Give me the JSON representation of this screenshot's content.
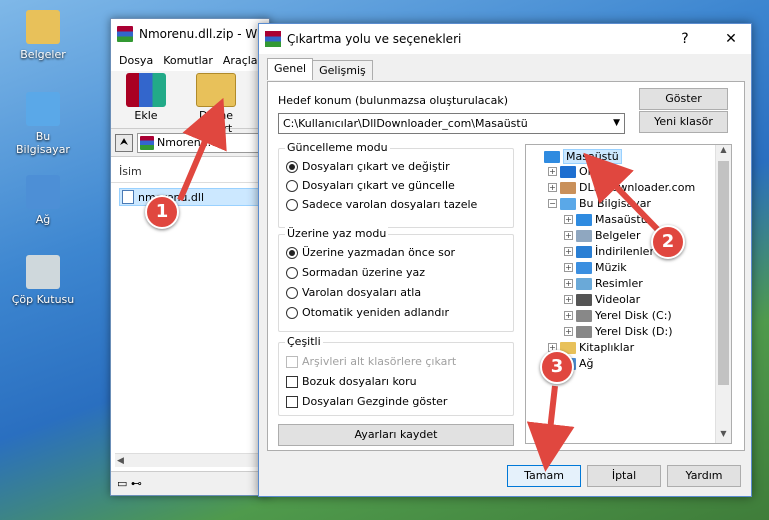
{
  "desktop": {
    "icons": [
      {
        "label": "Belgeler",
        "icon": "folder-documents-icon",
        "color": "#e8c15a"
      },
      {
        "label": "Bu Bilgisayar",
        "icon": "computer-icon",
        "color": "#5aa8e8"
      },
      {
        "label": "Ağ",
        "icon": "network-icon",
        "color": "#4d8fd6"
      },
      {
        "label": "Çöp Kutusu",
        "icon": "recycle-bin-icon",
        "color": "#cfd8dc"
      }
    ]
  },
  "winrar": {
    "title": "Nmorenu.dll.zip - Wi",
    "menu": [
      "Dosya",
      "Komutlar",
      "Araçla"
    ],
    "toolbar": {
      "add": "Ekle",
      "extract": "Dizine Çıkart"
    },
    "path": "Nmorenu.dll",
    "column": "İsim",
    "file": "nmorenu.dll"
  },
  "dialog": {
    "title": "Çıkartma yolu ve seçenekleri",
    "help": "?",
    "close": "✕",
    "tabs": [
      "Genel",
      "Gelişmiş"
    ],
    "target_label": "Hedef konum (bulunmazsa oluşturulacak)",
    "target_value": "C:\\Kullanıcılar\\DllDownloader_com\\Masaüstü",
    "show_button": "Göster",
    "new_folder_button": "Yeni klasör",
    "update_mode": {
      "title": "Güncelleme modu",
      "options": [
        "Dosyaları çıkart ve değiştir",
        "Dosyaları çıkart ve güncelle",
        "Sadece varolan dosyaları tazele"
      ],
      "selected": 0
    },
    "overwrite_mode": {
      "title": "Üzerine yaz modu",
      "options": [
        "Üzerine yazmadan önce sor",
        "Sormadan üzerine yaz",
        "Varolan dosyaları atla",
        "Otomatik yeniden adlandır"
      ],
      "selected": 0
    },
    "misc": {
      "title": "Çeşitli",
      "options": [
        "Arşivleri alt klasörlere çıkart",
        "Bozuk dosyaları koru",
        "Dosyaları Gezginde göster"
      ],
      "disabled": [
        true,
        false,
        false
      ]
    },
    "save_settings": "Ayarları kaydet",
    "tree": [
      {
        "label": "Masaüstü",
        "level": 0,
        "expander": "",
        "icon": "desktop-icon",
        "selected": true
      },
      {
        "label": "OneDrive",
        "level": 1,
        "expander": "+",
        "icon": "onedrive-icon"
      },
      {
        "label": "DLL Downloader.com",
        "level": 1,
        "expander": "+",
        "icon": "user-icon"
      },
      {
        "label": "Bu Bilgisayar",
        "level": 1,
        "expander": "−",
        "icon": "computer-icon"
      },
      {
        "label": "Masaüstü",
        "level": 2,
        "expander": "+",
        "icon": "desktop-icon"
      },
      {
        "label": "Belgeler",
        "level": 2,
        "expander": "+",
        "icon": "documents-icon"
      },
      {
        "label": "İndirilenler",
        "level": 2,
        "expander": "+",
        "icon": "downloads-icon"
      },
      {
        "label": "Müzik",
        "level": 2,
        "expander": "+",
        "icon": "music-icon"
      },
      {
        "label": "Resimler",
        "level": 2,
        "expander": "+",
        "icon": "pictures-icon"
      },
      {
        "label": "Videolar",
        "level": 2,
        "expander": "+",
        "icon": "videos-icon"
      },
      {
        "label": "Yerel Disk (C:)",
        "level": 2,
        "expander": "+",
        "icon": "drive-icon"
      },
      {
        "label": "Yerel Disk (D:)",
        "level": 2,
        "expander": "+",
        "icon": "drive-icon"
      },
      {
        "label": "Kitaplıklar",
        "level": 1,
        "expander": "+",
        "icon": "libraries-icon"
      },
      {
        "label": "Ağ",
        "level": 1,
        "expander": "+",
        "icon": "network-icon"
      }
    ],
    "ok": "Tamam",
    "cancel": "İptal",
    "help_button": "Yardım"
  },
  "annotations": {
    "badges": [
      "1",
      "2",
      "3"
    ],
    "color": "#e0473f"
  }
}
